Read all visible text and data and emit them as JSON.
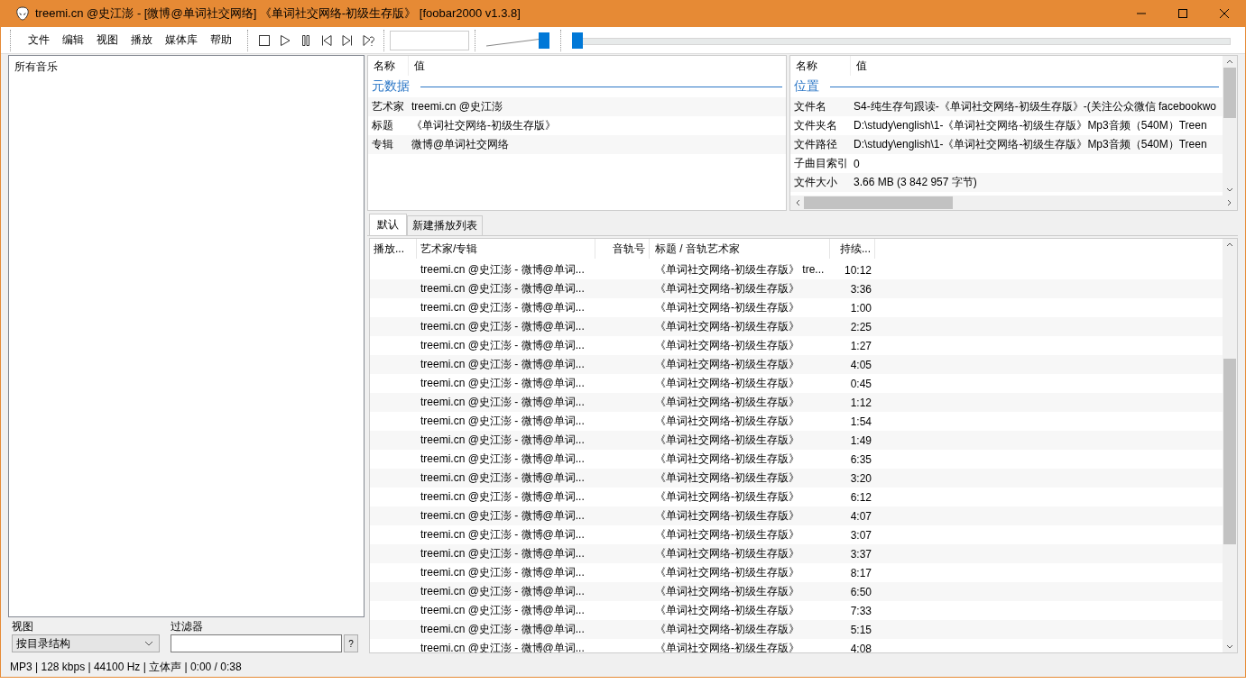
{
  "window": {
    "title": "treemi.cn @史江澎 - [微博@单词社交网络] 《单词社交网络-初级生存版》   [foobar2000 v1.3.8]"
  },
  "menu": [
    "文件",
    "编辑",
    "视图",
    "播放",
    "媒体库",
    "帮助"
  ],
  "transport": [
    {
      "kind": "stop"
    },
    {
      "kind": "play"
    },
    {
      "kind": "pause"
    },
    {
      "kind": "prev"
    },
    {
      "kind": "next"
    },
    {
      "kind": "random"
    }
  ],
  "volume": {
    "level": 1.0
  },
  "seek": {
    "level": 0
  },
  "library": {
    "root": "所有音乐",
    "view_label": "视图",
    "view_value": "按目录结构",
    "filter_label": "过滤器",
    "help": "?"
  },
  "properties_left": {
    "columns": [
      "名称",
      "值"
    ],
    "section": "元数据",
    "rows": [
      {
        "name": "艺术家",
        "value": "treemi.cn @史江澎"
      },
      {
        "name": "标题",
        "value": "《单词社交网络-初级生存版》"
      },
      {
        "name": "专辑",
        "value": "微博@单词社交网络"
      }
    ]
  },
  "properties_right": {
    "columns": [
      "名称",
      "值"
    ],
    "section": "位置",
    "rows": [
      {
        "name": "文件名",
        "value": "S4-纯生存句跟读-《单词社交网络-初级生存版》-(关注公众微信 facebookwo"
      },
      {
        "name": "文件夹名",
        "value": "D:\\study\\english\\1-《单词社交网络-初级生存版》Mp3音频（540M）Treen"
      },
      {
        "name": "文件路径",
        "value": "D:\\study\\english\\1-《单词社交网络-初级生存版》Mp3音频（540M）Treen"
      },
      {
        "name": "子曲目索引",
        "value": "0"
      },
      {
        "name": "文件大小",
        "value": "3.66 MB (3 842 957 字节)"
      }
    ]
  },
  "playlist_tabs": [
    {
      "label": "默认",
      "selected": true
    },
    {
      "label": "新建播放列表",
      "selected": false
    }
  ],
  "playlist": {
    "columns": [
      "播放...",
      "艺术家/专辑",
      "音轨号",
      "标题 / 音轨艺术家",
      "持续..."
    ],
    "rows": [
      {
        "artist": "treemi.cn @史江澎 - 微博@单词...",
        "title": "《单词社交网络-初级生存版》 tre...",
        "duration": "10:12"
      },
      {
        "artist": "treemi.cn @史江澎 - 微博@单词...",
        "title": "《单词社交网络-初级生存版》",
        "duration": "3:36"
      },
      {
        "artist": "treemi.cn @史江澎 - 微博@单词...",
        "title": "《单词社交网络-初级生存版》",
        "duration": "1:00"
      },
      {
        "artist": "treemi.cn @史江澎 - 微博@单词...",
        "title": "《单词社交网络-初级生存版》",
        "duration": "2:25"
      },
      {
        "artist": "treemi.cn @史江澎 - 微博@单词...",
        "title": "《单词社交网络-初级生存版》",
        "duration": "1:27"
      },
      {
        "artist": "treemi.cn @史江澎 - 微博@单词...",
        "title": "《单词社交网络-初级生存版》",
        "duration": "4:05"
      },
      {
        "artist": "treemi.cn @史江澎 - 微博@单词...",
        "title": "《单词社交网络-初级生存版》",
        "duration": "0:45"
      },
      {
        "artist": "treemi.cn @史江澎 - 微博@单词...",
        "title": "《单词社交网络-初级生存版》",
        "duration": "1:12"
      },
      {
        "artist": "treemi.cn @史江澎 - 微博@单词...",
        "title": "《单词社交网络-初级生存版》",
        "duration": "1:54"
      },
      {
        "artist": "treemi.cn @史江澎 - 微博@单词...",
        "title": "《单词社交网络-初级生存版》",
        "duration": "1:49"
      },
      {
        "artist": "treemi.cn @史江澎 - 微博@单词...",
        "title": "《单词社交网络-初级生存版》",
        "duration": "6:35"
      },
      {
        "artist": "treemi.cn @史江澎 - 微博@单词...",
        "title": "《单词社交网络-初级生存版》",
        "duration": "3:20"
      },
      {
        "artist": "treemi.cn @史江澎 - 微博@单词...",
        "title": "《单词社交网络-初级生存版》",
        "duration": "6:12"
      },
      {
        "artist": "treemi.cn @史江澎 - 微博@单词...",
        "title": "《单词社交网络-初级生存版》",
        "duration": "4:07"
      },
      {
        "artist": "treemi.cn @史江澎 - 微博@单词...",
        "title": "《单词社交网络-初级生存版》",
        "duration": "3:07"
      },
      {
        "artist": "treemi.cn @史江澎 - 微博@单词...",
        "title": "《单词社交网络-初级生存版》",
        "duration": "3:37"
      },
      {
        "artist": "treemi.cn @史江澎 - 微博@单词...",
        "title": "《单词社交网络-初级生存版》",
        "duration": "8:17"
      },
      {
        "artist": "treemi.cn @史江澎 - 微博@单词...",
        "title": "《单词社交网络-初级生存版》",
        "duration": "6:50"
      },
      {
        "artist": "treemi.cn @史江澎 - 微博@单词...",
        "title": "《单词社交网络-初级生存版》",
        "duration": "7:33"
      },
      {
        "artist": "treemi.cn @史江澎 - 微博@单词...",
        "title": "《单词社交网络-初级生存版》",
        "duration": "5:15"
      },
      {
        "artist": "treemi.cn @史江澎 - 微博@单词...",
        "title": "《单词社交网络-初级生存版》",
        "duration": "4:08"
      }
    ]
  },
  "status_bar": "MP3 | 128 kbps | 44100 Hz | 立体声 | 0:00 / 0:38"
}
